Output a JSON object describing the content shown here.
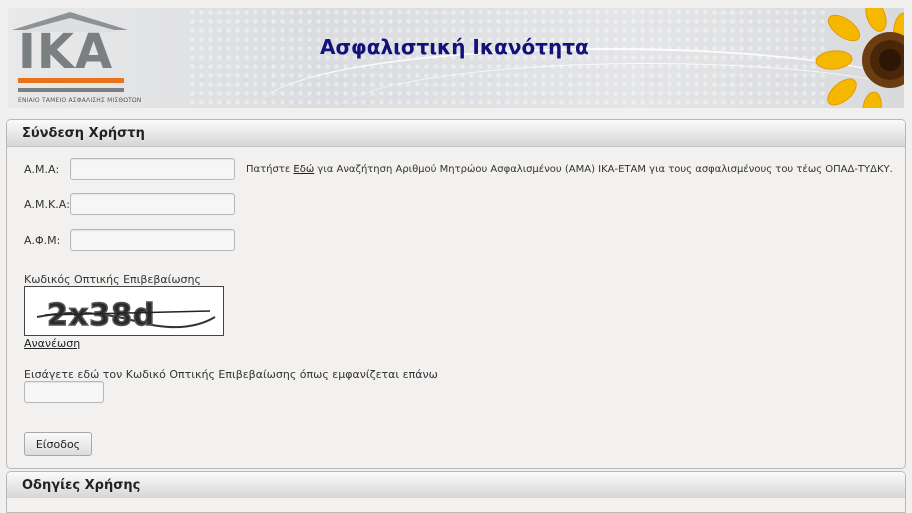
{
  "header": {
    "logo_text": "IKA",
    "logo_tagline": "ΕΝΙΑΙΟ ΤΑΜΕΙΟ ΑΣΦΑΛΙΣΗΣ ΜΙΣΘΩΤΩΝ",
    "title": "Ασφαλιστική Ικανότητα",
    "accent_color": "#e8731b",
    "title_color": "#12127a"
  },
  "login": {
    "heading": "Σύνδεση Χρήστη",
    "ama_label": "Α.Μ.Α:",
    "ama_value": "",
    "hint_prefix": "Πατήστε ",
    "hint_link": "Εδώ",
    "hint_suffix": " για Αναζήτηση Αριθμού Μητρώου Ασφαλισμένου (ΑΜΑ) ΙΚΑ-ΕΤΑΜ για τους ασφαλισμένους του τέως ΟΠΑΔ-ΤΥΔΚΥ.",
    "amka_label": "Α.Μ.Κ.Α:",
    "amka_value": "",
    "afm_label": "Α.Φ.Μ:",
    "afm_value": "",
    "captcha_label": "Κωδικός Οπτικής Επιβεβαίωσης",
    "captcha_text": "2x38d",
    "refresh_link": "Ανανέωση",
    "captcha_entry_label": "Εισάγετε εδώ τον Κωδικό Οπτικής Επιβεβαίωσης όπως εμφανίζεται επάνω",
    "captcha_entry_value": "",
    "submit_label": "Είσοδος"
  },
  "help": {
    "heading": "Οδηγίες Χρήσης"
  }
}
